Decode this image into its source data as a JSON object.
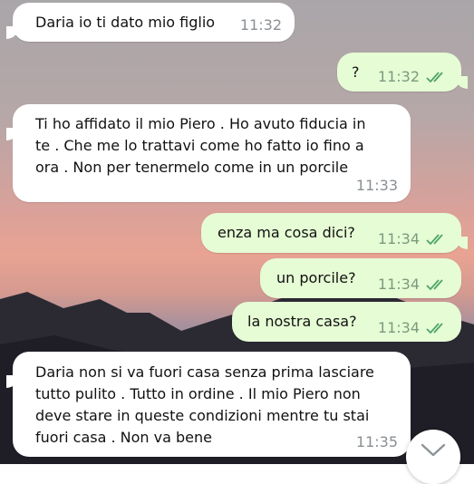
{
  "messages": [
    {
      "direction": "in",
      "text": "Daria io ti dato mio figlio",
      "time": "11:32"
    },
    {
      "direction": "out",
      "text": "?",
      "time": "11:32",
      "status": "read"
    },
    {
      "direction": "in",
      "text": "Ti ho affidato il mio Piero . Ho avuto fiducia in\nte . Che me lo trattavi come ho fatto io fino a\nora . Non per tenermelo come in un porcile",
      "time": "11:33"
    },
    {
      "direction": "out",
      "text": "enza ma cosa dici?",
      "time": "11:34",
      "status": "read"
    },
    {
      "direction": "out",
      "text": "un porcile?",
      "time": "11:34",
      "status": "read"
    },
    {
      "direction": "out",
      "text": "la nostra casa?",
      "time": "11:34",
      "status": "read"
    },
    {
      "direction": "in",
      "text": "Daria non si va fuori casa senza prima lasciare\ntutto pulito . Tutto in ordine . Il mio Piero non\ndeve stare in queste condizioni mentre tu stai\nfuori casa . Non va bene",
      "time": "11:35"
    }
  ],
  "icons": {
    "read_ticks": "double-check-icon",
    "scroll_down": "chevron-down-icon"
  },
  "colors": {
    "incoming_bubble": "#ffffff",
    "outgoing_bubble": "#e6fcd5",
    "read_tick": "#4fa36b",
    "time_text": "#8a8f94"
  }
}
